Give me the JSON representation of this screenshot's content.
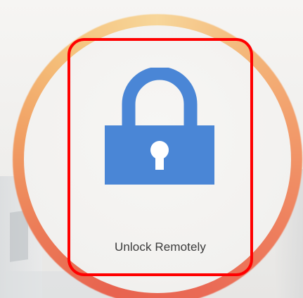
{
  "unlock_button": {
    "label": "Unlock Remotely"
  },
  "icons": {
    "lock": "lock-icon"
  },
  "colors": {
    "lock_blue": "#4a86d6",
    "lock_keyhole": "#ffffff",
    "highlight": "#ff0000",
    "ring_warm": "#ee7f5e",
    "ring_light": "#f7d69a"
  }
}
